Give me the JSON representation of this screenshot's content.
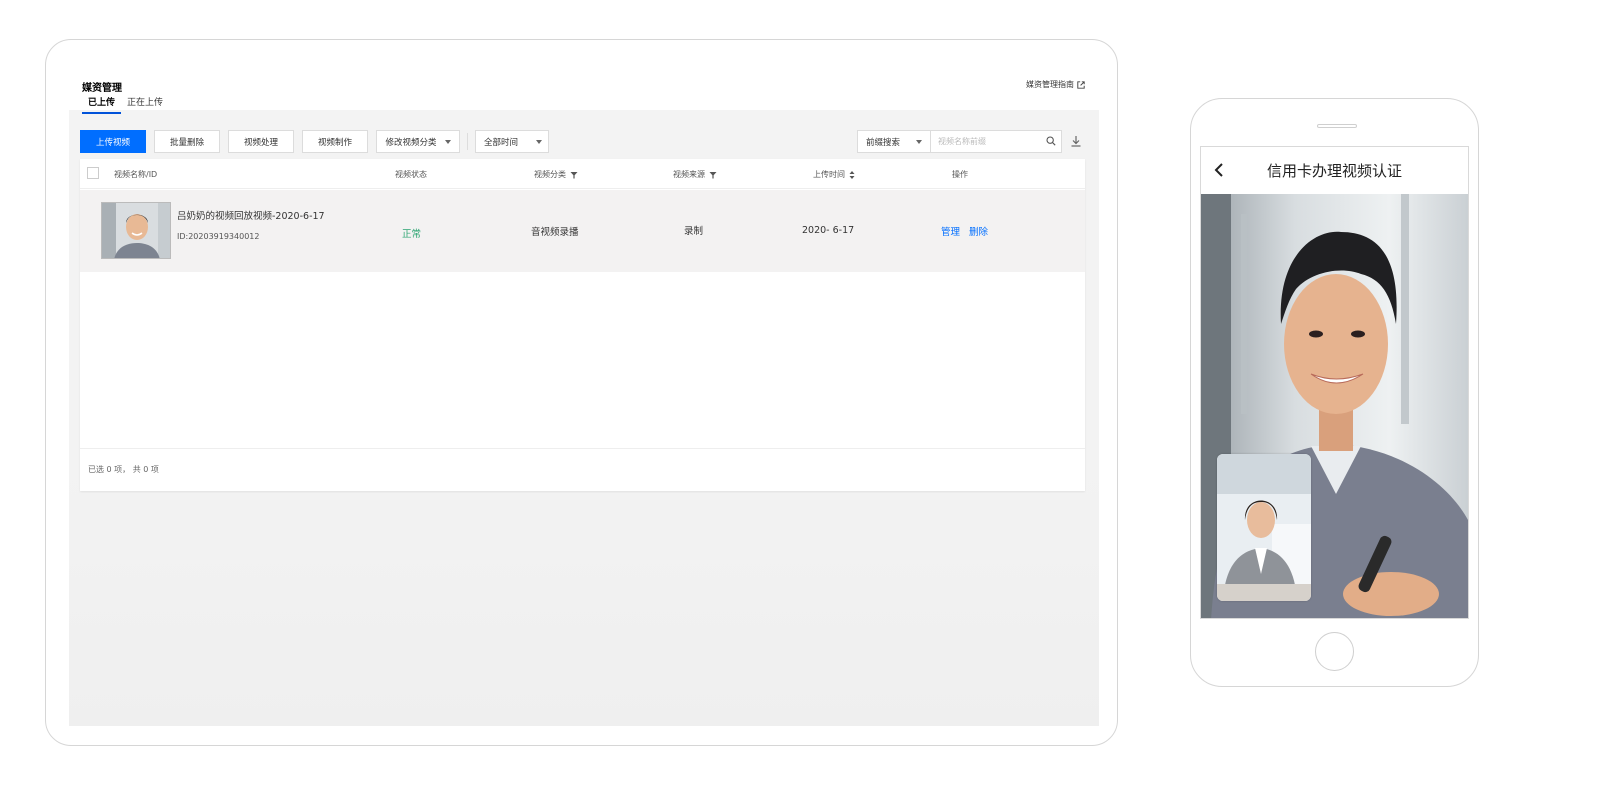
{
  "console": {
    "title": "媒资管理",
    "guide_link": "媒资管理指南",
    "tabs": [
      {
        "label": "已上传",
        "active": true
      },
      {
        "label": "正在上传",
        "active": false
      }
    ],
    "toolbar": {
      "upload": "上传视频",
      "batch_delete": "批量删除",
      "video_process": "视频处理",
      "video_make": "视频制作",
      "change_category": "修改视频分类",
      "time_filter": "全部时间",
      "search_mode": "前缀搜索",
      "search_placeholder": "视频名称前缀"
    },
    "table": {
      "columns": [
        "视频名称/ID",
        "视频状态",
        "视频分类",
        "视频来源",
        "上传时间",
        "操作"
      ],
      "rows": [
        {
          "name": "吕奶奶的视频回放视频-2020-6-17",
          "id": "ID:20203919340012",
          "status": "正常",
          "category": "音视频录播",
          "source": "录制",
          "upload_time": "2020- 6-17",
          "actions": [
            "管理",
            "删除"
          ]
        }
      ],
      "footer": "已选 0 项， 共 0 项"
    }
  },
  "phone": {
    "title": "信用卡办理视频认证"
  },
  "colors": {
    "primary": "#006eff",
    "status_ok": "#2ba471",
    "tab_underline": "#0052d9"
  },
  "icons": [
    "external-link-icon",
    "search-icon",
    "download-icon",
    "filter-icon",
    "sort-icon",
    "back-icon"
  ]
}
